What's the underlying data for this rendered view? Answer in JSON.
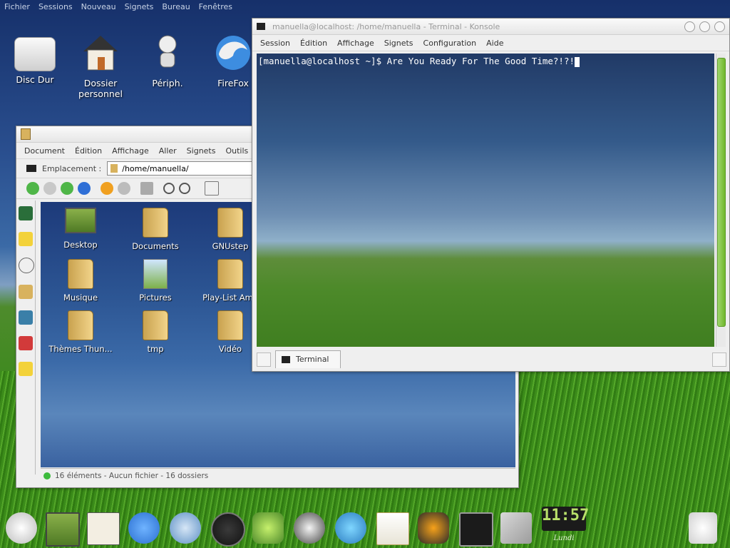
{
  "top_menu": [
    "Fichier",
    "Sessions",
    "Nouveau",
    "Signets",
    "Bureau",
    "Fenêtres"
  ],
  "desktop_icons": [
    {
      "label": "Disc Dur",
      "icon": "drive-icon"
    },
    {
      "label": "Dossier personnel",
      "icon": "home-icon"
    },
    {
      "label": "Périph.",
      "icon": "robot-icon"
    },
    {
      "label": "FireFox",
      "icon": "firefox-icon"
    }
  ],
  "konqueror": {
    "menu": [
      "Document",
      "Édition",
      "Affichage",
      "Aller",
      "Signets",
      "Outils"
    ],
    "location_label": "Emplacement :",
    "path": "/home/manuella/",
    "files": [
      {
        "name": "Desktop"
      },
      {
        "name": "Documents"
      },
      {
        "name": "GNUstep"
      },
      {
        "name": "Musique"
      },
      {
        "name": "Pictures"
      },
      {
        "name": "Play-List Ama"
      },
      {
        "name": "Thèmes Thun..."
      },
      {
        "name": "tmp"
      },
      {
        "name": "Vidéo"
      }
    ],
    "status": "16 éléments - Aucun fichier - 16 dossiers"
  },
  "konsole": {
    "title": "manuella@localhost: /home/manuella - Terminal - Konsole",
    "menu": [
      "Session",
      "Édition",
      "Affichage",
      "Signets",
      "Configuration",
      "Aide"
    ],
    "prompt_line": "[manuella@localhost ~]$ Are You Ready For The Good Time?!?!",
    "tab_label": "Terminal"
  },
  "clock": {
    "time": "11:57",
    "day": "Lundi"
  },
  "colors": {
    "accent": "#6fb62c",
    "window_bg": "#efefef"
  }
}
